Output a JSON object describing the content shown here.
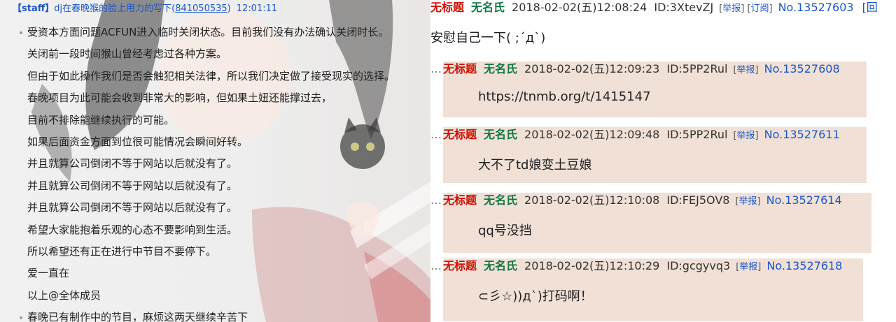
{
  "announcement": {
    "title_tag": "【staff】",
    "title_rest": "dj在春晚猴的脸上用力的写下",
    "link_text": "841050535",
    "time": "12:01:11",
    "lines": [
      {
        "text": "受资本方面问题ACFUN进入临时关闭状态。目前我们没有办法确认关闭时长。",
        "bullet": true
      },
      {
        "text": "关闭前一段时间猴山曾经考虑过各种方案。",
        "bullet": false
      },
      {
        "text": "但由于如此操作我们是否会触犯相关法律，所以我们决定做了接受现实的选择。",
        "bullet": false
      },
      {
        "text": "春晚项目为此可能会收到非常大的影响，但如果土妞还能撑过去，",
        "bullet": false
      },
      {
        "text": "目前不排除能继续执行的可能。",
        "bullet": false
      },
      {
        "text": "如果后面资金方面到位很可能情况会瞬间好转。",
        "bullet": false
      },
      {
        "text": "并且就算公司倒闭不等于网站以后就没有了。",
        "bullet": false
      },
      {
        "text": "并且就算公司倒闭不等于网站以后就没有了。",
        "bullet": false
      },
      {
        "text": "并且就算公司倒闭不等于网站以后就没有了。",
        "bullet": false
      },
      {
        "text": "希望大家能抱着乐观的心态不要影响到生活。",
        "bullet": false
      },
      {
        "text": "所以希望还有正在进行中节目不要停下。",
        "bullet": false
      },
      {
        "text": "爱一直在",
        "bullet": false
      },
      {
        "text": "以上@全体成员",
        "bullet": false
      },
      {
        "text": "春晚已有制作中的节目，麻烦这两天继续辛苦下",
        "bullet": true
      }
    ]
  },
  "thread": {
    "title": "无标题",
    "name": "无名氏",
    "datetime": "2018-02-02(五)12:08:24",
    "id": "ID:3XtevZJ",
    "report": "举报",
    "subscribe": "订阅",
    "no": "No.13527603",
    "extra": "[回",
    "body": "安慰自己一下( ;´д`)"
  },
  "replies": [
    {
      "arrow": "…",
      "title": "无标题",
      "name": "无名氏",
      "datetime": "2018-02-02(五)12:09:23",
      "id": "ID:5PP2Rul",
      "report": "举报",
      "no": "No.13527608",
      "body": "https://tnmb.org/t/1415147"
    },
    {
      "arrow": "…",
      "title": "无标题",
      "name": "无名氏",
      "datetime": "2018-02-02(五)12:09:48",
      "id": "ID:5PP2Rul",
      "report": "举报",
      "no": "No.13527611",
      "body": "大不了td娘变土豆娘"
    },
    {
      "arrow": "…",
      "title": "无标题",
      "name": "无名氏",
      "datetime": "2018-02-02(五)12:10:08",
      "id": "ID:FEJ5OV8",
      "report": "举报",
      "no": "No.13527614",
      "body": "qq号没挡"
    },
    {
      "arrow": "…",
      "title": "无标题",
      "name": "无名氏",
      "datetime": "2018-02-02(五)12:10:29",
      "id": "ID:gcgyvq3",
      "report": "举报",
      "no": "No.13527618",
      "body": "⊂彡☆))д`)打码啊！"
    }
  ],
  "colors": {
    "title_red": "#cc1105",
    "name_green": "#117743",
    "link_blue": "#1a56c9",
    "reply_bg": "#f0e0d6"
  }
}
